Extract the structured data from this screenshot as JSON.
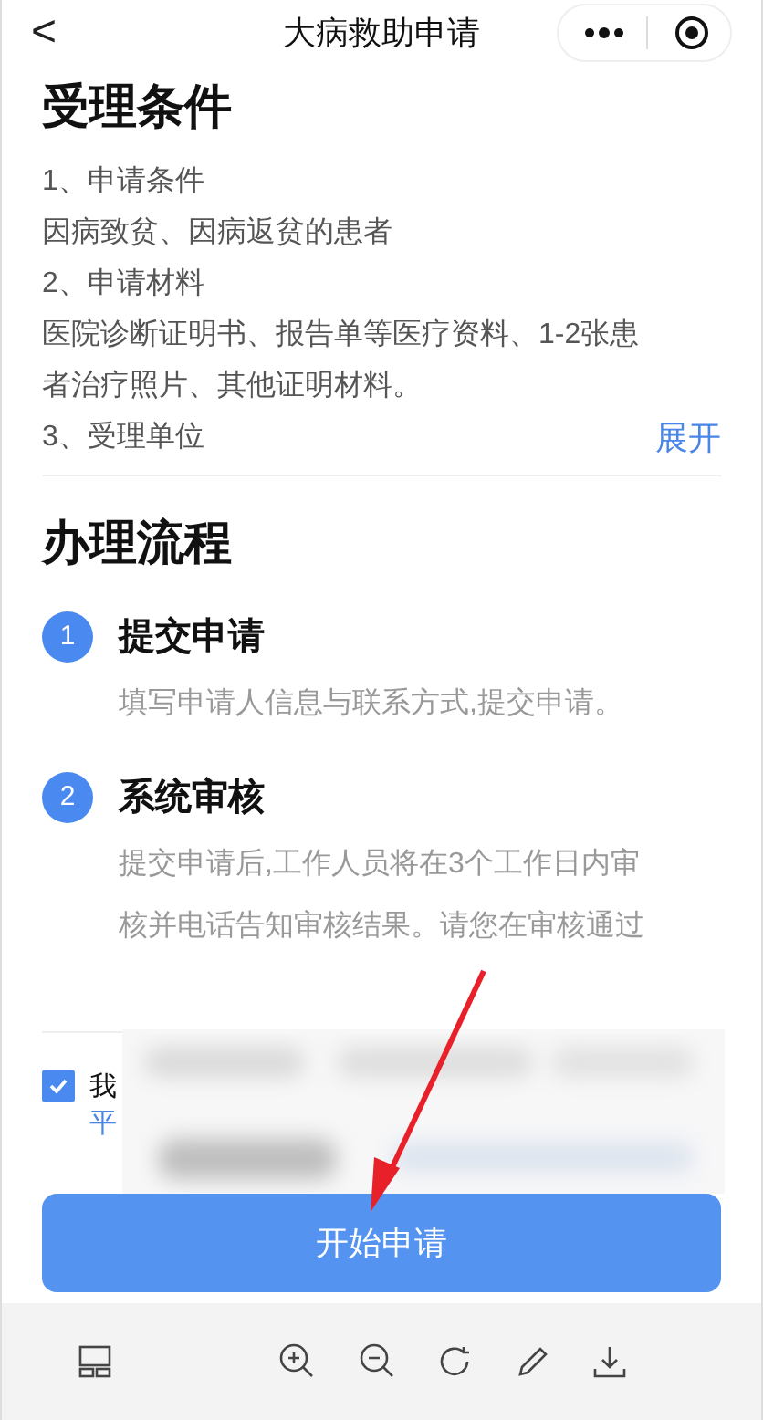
{
  "header": {
    "back": "<",
    "title": "大病救助申请"
  },
  "conditions": {
    "title": "受理条件",
    "lines": [
      "1、申请条件",
      "因病致贫、因病返贫的患者",
      "2、申请材料",
      "医院诊断证明书、报告单等医疗资料、1-2张患者治疗照片、其他证明材料。",
      "3、受理单位"
    ],
    "expand": "展开"
  },
  "process": {
    "title": "办理流程",
    "steps": [
      {
        "number": "1",
        "title": "提交申请",
        "text": "填写申请人信息与联系方式,提交申请。"
      },
      {
        "number": "2",
        "title": "系统审核",
        "text": "提交申请后,工作人员将在3个工作日内审核并电话告知审核结果。请您在审核通过"
      }
    ]
  },
  "agreement": {
    "checked": true,
    "text": "我",
    "link": "平"
  },
  "button": "开始申请"
}
